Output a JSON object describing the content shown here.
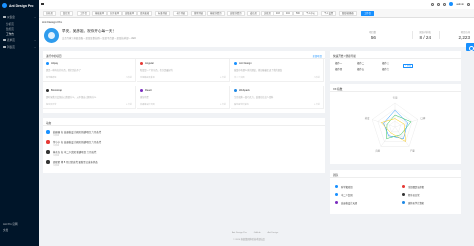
{
  "app": {
    "title": "Ant Design Pro"
  },
  "sider": {
    "menu": [
      {
        "label": "仪表盘",
        "icon": "dashboard-icon"
      },
      {
        "label": "表单页",
        "icon": "form-icon"
      },
      {
        "label": "列表页",
        "icon": "table-icon"
      }
    ],
    "submenu": [
      "分析页",
      "监控页",
      "工作台"
    ],
    "bottom": [
      "Ant Pro 官网",
      "文档"
    ]
  },
  "header": {
    "user": "admin"
  },
  "tabs": [
    "分析页",
    "监控页",
    "工作台",
    "基础表单",
    "分步表单",
    "高级表单",
    "查询表格",
    "标准列表",
    "卡片列表",
    "搜索列表",
    "基础详情页",
    "高级详情页",
    "成功页",
    "失败页",
    "403",
    "404",
    "500",
    "个人中心",
    "个人设置",
    "图形编辑器",
    "工作台"
  ],
  "page": {
    "title": "Ant Design Pro",
    "greeting": "早安，吴彦祖，祝你开心每一天！",
    "desc": "交互专家 | 蚂蚁金服－某某某事业群－某某平台部－某某技术部－UED",
    "stats": [
      {
        "label": "项目数",
        "value": "56"
      },
      {
        "label": "团队内排名",
        "value": "8 / 24"
      },
      {
        "label": "项目访问",
        "value": "2,223"
      }
    ]
  },
  "projects": {
    "title": "进行中的项目",
    "extra": "全部项目",
    "items": [
      {
        "name": "Alipay",
        "desc": "那是一种内在的东西，他们到达不了",
        "team": "科学搬砖组",
        "time": "几秒前",
        "color": "#1890ff"
      },
      {
        "name": "Angular",
        "desc": "希望是一个好东西，也许是最好的",
        "team": "全组都是吴彦祖",
        "time": "6 年前",
        "color": "#e53935"
      },
      {
        "name": "Ant Design",
        "desc": "城镇中有那么多的酒馆，她却偏偏走进了我的酒馆",
        "team": "中二少女团",
        "time": "几秒前",
        "color": "#1890ff"
      },
      {
        "name": "Bootstrap",
        "desc": "那时候我只会想自己想要什么，从不想自己拥有什么",
        "team": "程序员日常",
        "time": "6 年前",
        "color": "#333"
      },
      {
        "name": "React",
        "desc": "凛冬将至",
        "team": "高逼格设计天团",
        "time": "6 年前",
        "color": "#7b2cbf"
      },
      {
        "name": "Webpack",
        "desc": "生命就像一盒巧克力，结果往往出人意料",
        "team": "骗你来学计算机",
        "time": "6 年前",
        "color": "#1e88e5"
      }
    ]
  },
  "dynamic": {
    "title": "动态",
    "items": [
      {
        "text": "曲丽丽 在 高逼格设计天团 新建项目 六月迭代",
        "time": "几秒前",
        "color": "#1890ff"
      },
      {
        "text": "付小小 在 高逼格设计天团 新建项目 六月迭代",
        "time": "几秒前",
        "color": "#e53935"
      },
      {
        "text": "林东东 在 中二少女团 新建项目 六月迭代",
        "time": "几秒前",
        "color": "#333"
      },
      {
        "text": "周星星 将 5 月日常迭代 更新至已发布状态",
        "time": "几秒前",
        "color": "#333"
      }
    ]
  },
  "quick": {
    "title": "快速开始 / 便捷导航",
    "items": [
      "操作一",
      "操作二",
      "操作三",
      "操作四",
      "操作五",
      "操作六"
    ],
    "add": "+ 添加"
  },
  "radar": {
    "title": "XX 指数",
    "axes": [
      "引用",
      "口碑",
      "产量",
      "贡献",
      "热度"
    ]
  },
  "team": {
    "title": "团队",
    "items": [
      {
        "name": "科学搬砖组",
        "color": "#1890ff"
      },
      {
        "name": "全组都是吴彦祖",
        "color": "#e53935"
      },
      {
        "name": "中二少女团",
        "color": "#1890ff"
      },
      {
        "name": "程序员日常",
        "color": "#333"
      },
      {
        "name": "高逼格设计天团",
        "color": "#7b2cbf"
      },
      {
        "name": "骗你来学计算机",
        "color": "#1e88e5"
      }
    ]
  },
  "footer": {
    "links": [
      "Ant Design Pro",
      "GitHub",
      "Ant Design"
    ],
    "copy": "© 2024 蚂蚁集团体验技术部出品"
  }
}
